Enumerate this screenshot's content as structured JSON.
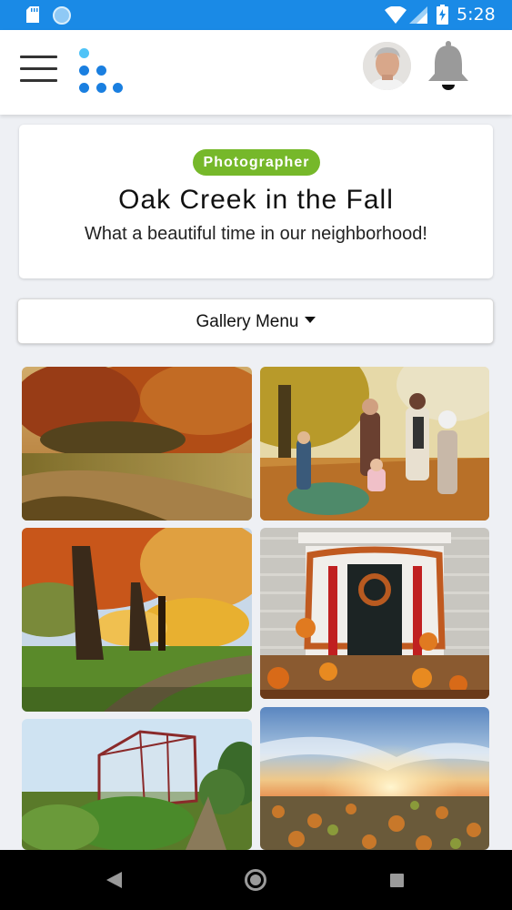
{
  "status_bar": {
    "time": "5:28"
  },
  "app_bar": {
    "menu_icon": "hamburger-icon",
    "logo_icon": "dots-logo",
    "avatar": "user-avatar",
    "notifications_icon": "bell-icon"
  },
  "hero": {
    "badge": "Photographer",
    "title": "Oak Creek in the Fall",
    "subtitle": "What a beautiful time in our neighborhood!"
  },
  "gallery_menu": {
    "label": "Gallery Menu"
  },
  "gallery": {
    "photos": [
      {
        "subject": "autumn path with orange trees"
      },
      {
        "subject": "family playing in fall leaves"
      },
      {
        "subject": "park trees with golden foliage"
      },
      {
        "subject": "front door decorated with pumpkins"
      },
      {
        "subject": "greenhouse in community garden"
      },
      {
        "subject": "sunset over autumn town"
      }
    ]
  },
  "nav_bar": {
    "back_icon": "back-icon",
    "home_icon": "home-icon",
    "recents_icon": "recents-icon"
  },
  "colors": {
    "status_bar": "#1a8ae6",
    "badge": "#76b82a",
    "logo": "#1a7fe0"
  }
}
